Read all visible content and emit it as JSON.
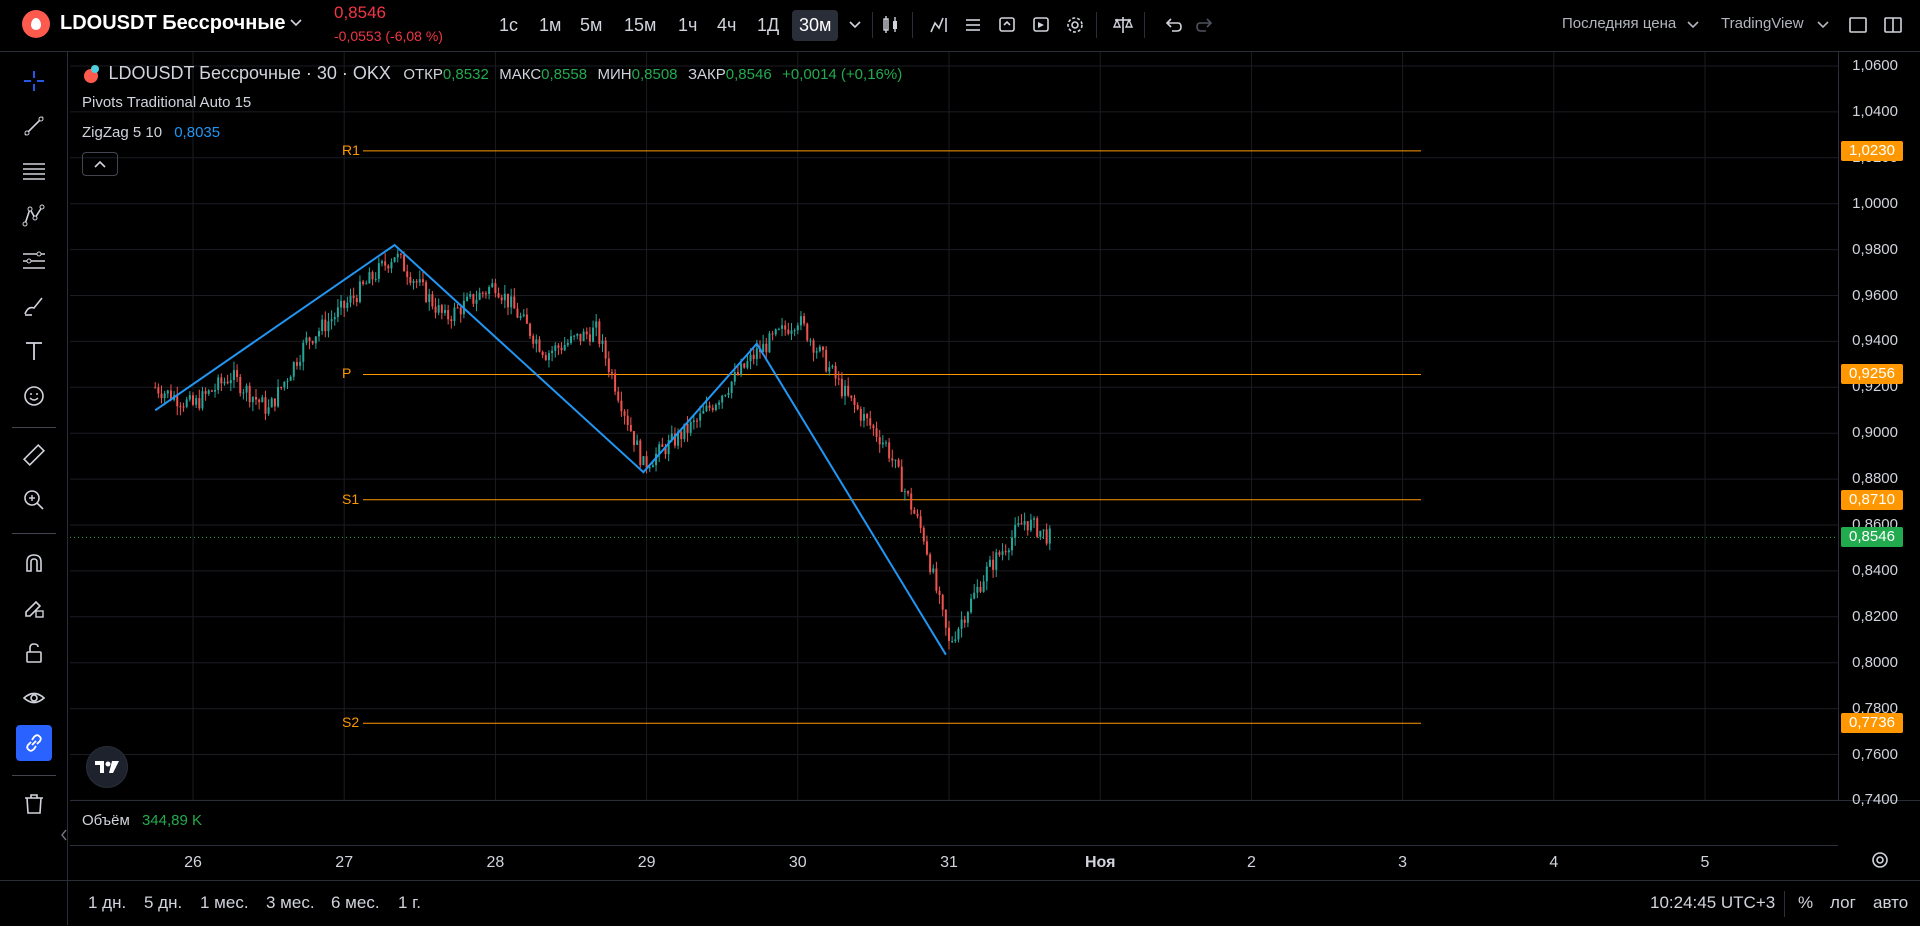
{
  "header": {
    "symbol": "LDOUSDT Бессрочные",
    "price": "0,8546",
    "change": "-0,0553 (-6,08 %)",
    "timeframes": [
      "1с",
      "1м",
      "5м",
      "15м",
      "1ч",
      "4ч",
      "1Д",
      "30м"
    ],
    "active_timeframe": "30м",
    "price_type": "Последняя цена",
    "provider": "TradingView"
  },
  "legend": {
    "title": "LDOUSDT Бессрочные · 30 · OKX",
    "open_label": "ОТКР",
    "open": "0,8532",
    "high_label": "МАКС",
    "high": "0,8558",
    "low_label": "МИН",
    "low": "0,8508",
    "close_label": "ЗАКР",
    "close": "0,8546",
    "change": "+0,0014 (+0,16%)",
    "pivots": "Pivots Traditional Auto 15",
    "zigzag": "ZigZag 5 10",
    "zigzag_value": "0,8035"
  },
  "pivots": {
    "r1_label": "R1",
    "r1": "1,0230",
    "p_label": "P",
    "p": "0,9256",
    "s1_label": "S1",
    "s1": "0,8710",
    "s2_label": "S2",
    "s2": "0,7736"
  },
  "price_axis": {
    "labels": [
      "1,0600",
      "1,0400",
      "1,0200",
      "1,0000",
      "0,9800",
      "0,9600",
      "0,9400",
      "0,9200",
      "0,9000",
      "0,8800",
      "0,8600",
      "0,8400",
      "0,8200",
      "0,8000",
      "0,7800",
      "0,7600",
      "0,7400"
    ],
    "current": "0,8546"
  },
  "time_axis": {
    "labels": [
      "26",
      "27",
      "28",
      "29",
      "30",
      "31",
      "Ноя",
      "2",
      "3",
      "4",
      "5"
    ]
  },
  "volume": {
    "label": "Объём",
    "value": "344,89 K"
  },
  "bottom": {
    "ranges": [
      "1 дн.",
      "5 дн.",
      "1 мес.",
      "3 мес.",
      "6 мес.",
      "1 г."
    ],
    "clock": "10:24:45 UTC+3",
    "percent": "%",
    "log": "лог",
    "auto": "авто"
  },
  "colors": {
    "up": "#26a69a",
    "down": "#ef5350",
    "pivot": "#ff9800",
    "zigzag": "#2196f3",
    "current_tag": "#22ab4e"
  },
  "chart_data": {
    "type": "candlestick",
    "interval": "30m",
    "ylim": [
      0.735,
      1.065
    ],
    "zigzag_points": [
      {
        "date": "Oct 25 18:00",
        "value": 0.91
      },
      {
        "date": "Oct 27 08:00",
        "value": 0.982
      },
      {
        "date": "Oct 28 23:30",
        "value": 0.883
      },
      {
        "date": "Oct 29 17:30",
        "value": 0.939
      },
      {
        "date": "Oct 30 23:30",
        "value": 0.8035
      }
    ],
    "last_close": 0.8546,
    "price_path": [
      {
        "date": "Oct 25 18:00",
        "value": 0.92
      },
      {
        "date": "Oct 26 00:00",
        "value": 0.912
      },
      {
        "date": "Oct 26 06:00",
        "value": 0.925
      },
      {
        "date": "Oct 26 12:00",
        "value": 0.91
      },
      {
        "date": "Oct 26 18:00",
        "value": 0.94
      },
      {
        "date": "Oct 27 00:00",
        "value": 0.955
      },
      {
        "date": "Oct 27 08:00",
        "value": 0.978
      },
      {
        "date": "Oct 27 16:00",
        "value": 0.95
      },
      {
        "date": "Oct 28 00:00",
        "value": 0.965
      },
      {
        "date": "Oct 28 08:00",
        "value": 0.935
      },
      {
        "date": "Oct 28 16:00",
        "value": 0.945
      },
      {
        "date": "Oct 28 23:30",
        "value": 0.886
      },
      {
        "date": "Oct 29 08:00",
        "value": 0.905
      },
      {
        "date": "Oct 29 17:30",
        "value": 0.935
      },
      {
        "date": "Oct 30 00:00",
        "value": 0.95
      },
      {
        "date": "Oct 30 08:00",
        "value": 0.915
      },
      {
        "date": "Oct 30 14:00",
        "value": 0.895
      },
      {
        "date": "Oct 30 20:00",
        "value": 0.855
      },
      {
        "date": "Oct 31 00:00",
        "value": 0.808
      },
      {
        "date": "Oct 31 06:00",
        "value": 0.84
      },
      {
        "date": "Oct 31 12:00",
        "value": 0.862
      },
      {
        "date": "Oct 31 16:00",
        "value": 0.8546
      }
    ]
  }
}
